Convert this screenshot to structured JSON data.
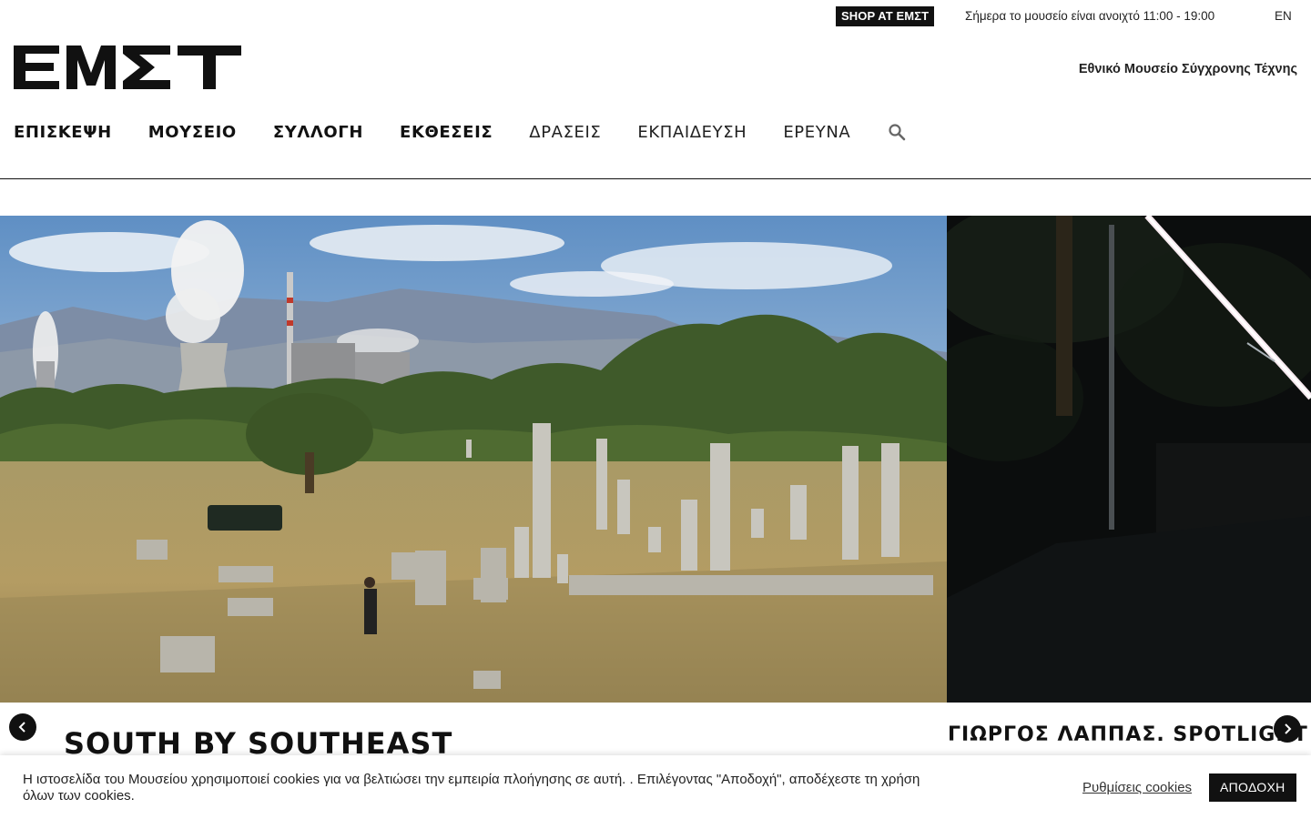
{
  "topbar": {
    "shop_label": "SHOP AT ΕΜΣΤ",
    "hours_text": "Σήμερα το μουσείο είναι ανοιχτό 11:00 - 19:00",
    "language": "EN"
  },
  "header": {
    "logo_text": "ΕΜΣΤ",
    "museum_name": "Εθνικό Μουσείο Σύγχρονης Τέχνης"
  },
  "nav": {
    "items": [
      {
        "label": "ΕΠΙΣΚΕΨΗ"
      },
      {
        "label": "ΜΟΥΣΕΙΟ"
      },
      {
        "label": "ΣΥΛΛΟΓΗ"
      },
      {
        "label": "ΕΚΘΕΣΕΙΣ"
      },
      {
        "label": "ΔΡΑΣΕΙΣ"
      },
      {
        "label": "ΕΚΠΑΙΔΕΥΣΗ"
      },
      {
        "label": "ΕΡΕΥΝΑ"
      }
    ],
    "search_icon": "search-icon"
  },
  "slider": {
    "slides": [
      {
        "title": "SOUTH BY SOUTHEAST"
      },
      {
        "title": "ΓΙΩΡΓΟΣ ΛΑΠΠΑΣ. SPOTLIGHT"
      }
    ],
    "prev_icon": "chevron-left-icon",
    "next_icon": "chevron-right-icon"
  },
  "cookies": {
    "text": "Η ιστοσελίδα του Μουσείου χρησιμοποιεί cookies για να βελτιώσει την εμπειρία πλοήγησης σε αυτή. . Επιλέγοντας \"Αποδοχή\", αποδέχεστε τη χρήση όλων των cookies.",
    "settings_label": "Ρυθμίσεις cookies",
    "accept_label": "ΑΠΟΔΟΧΗ"
  },
  "colors": {
    "primary": "#111111",
    "background": "#ffffff"
  }
}
